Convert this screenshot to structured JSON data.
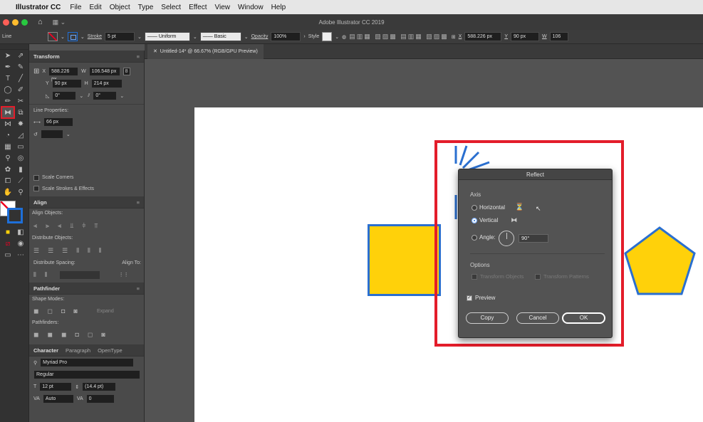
{
  "menubar": {
    "app": "Illustrator CC",
    "items": [
      "File",
      "Edit",
      "Object",
      "Type",
      "Select",
      "Effect",
      "View",
      "Window",
      "Help"
    ]
  },
  "appbar": {
    "title": "Adobe Illustrator CC 2019"
  },
  "control": {
    "selection": "Line",
    "stroke_label": "Stroke",
    "stroke_value": "5 pt",
    "profile": "Uniform",
    "brush": "Basic",
    "opacity_label": "Opacity",
    "opacity": "100%",
    "style_label": "Style",
    "x_label": "X",
    "x": "588.226 px",
    "y_label": "Y",
    "y": "90 px",
    "w_label": "W",
    "w": "106"
  },
  "doc": {
    "tab": "Untitled-14* @ 66.67% (RGB/GPU Preview)"
  },
  "transform": {
    "title": "Transform",
    "x_label": "X",
    "x": "588.226 px",
    "w_label": "W",
    "w": "106.548 px",
    "y_label": "Y",
    "y": "90 px",
    "h_label": "H",
    "h": "214 px",
    "rotate": "0°",
    "shear": "0°",
    "line_props": "Line Properties:",
    "length": "66 px",
    "scale_corners": "Scale Corners",
    "scale_strokes": "Scale Strokes & Effects"
  },
  "align": {
    "title": "Align",
    "objects": "Align Objects:",
    "distribute": "Distribute Objects:",
    "spacing": "Distribute Spacing:",
    "align_to": "Align To:"
  },
  "pathfinder": {
    "title": "Pathfinder",
    "shape_modes": "Shape Modes:",
    "expand": "Expand",
    "pathfinders": "Pathfinders:"
  },
  "character": {
    "tabs": [
      "Character",
      "Paragraph",
      "OpenType"
    ],
    "font": "Myriad Pro",
    "style": "Regular",
    "size": "12 pt",
    "leading": "(14.4 pt)",
    "kerning": "Auto",
    "tracking": "0"
  },
  "reflect": {
    "title": "Reflect",
    "axis": "Axis",
    "horizontal": "Horizontal",
    "vertical": "Vertical",
    "angle_label": "Angle:",
    "angle": "90°",
    "options": "Options",
    "transform_objects": "Transform Objects",
    "transform_patterns": "Transform Patterns",
    "preview": "Preview",
    "copy": "Copy",
    "cancel": "Cancel",
    "ok": "OK",
    "selected_axis": "vertical"
  },
  "colors": {
    "accent": "#1e6fd9",
    "highlight": "#e31d2a",
    "shape_fill": "#ffd10a",
    "shape_stroke": "#2a6fd0"
  }
}
